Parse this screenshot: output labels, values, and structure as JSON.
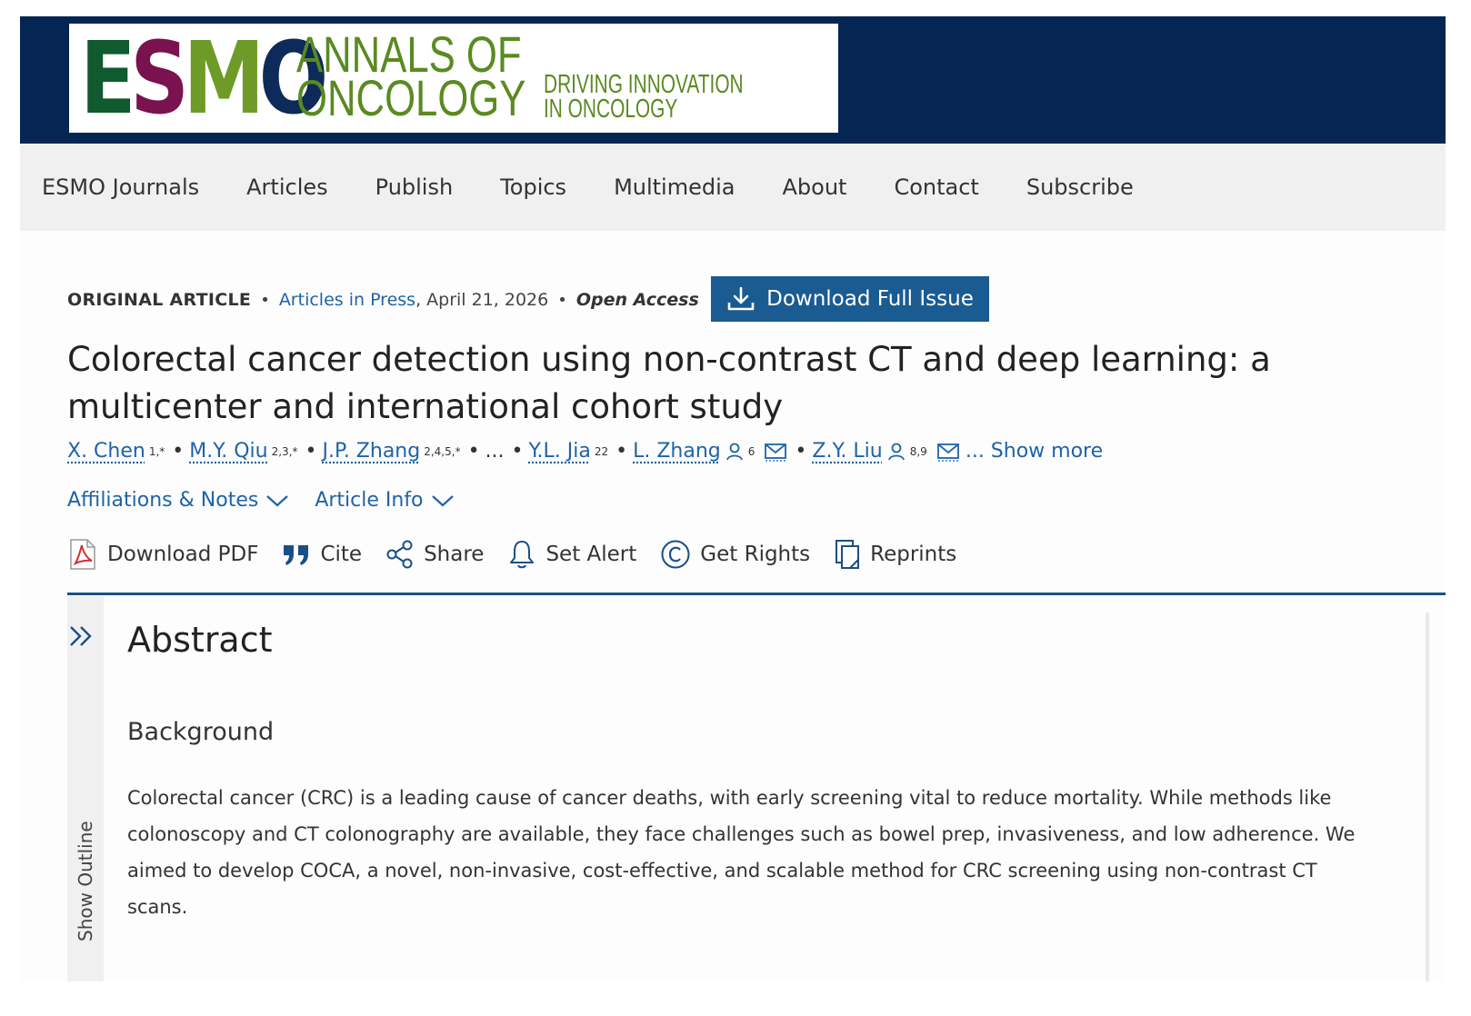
{
  "header": {
    "logo_letters": [
      "E",
      "S",
      "M",
      "O"
    ],
    "journal_line1": "ANNALS OF",
    "journal_line2": "ONCOLOGY",
    "tagline_line1": "DRIVING INNOVATION",
    "tagline_line2": "IN ONCOLOGY",
    "banner_color": "#052653"
  },
  "nav": {
    "items": [
      "ESMO Journals",
      "Articles",
      "Publish",
      "Topics",
      "Multimedia",
      "About",
      "Contact",
      "Subscribe"
    ]
  },
  "article": {
    "type": "ORIGINAL ARTICLE",
    "section_link": "Articles in Press",
    "date": ", April 21, 2026",
    "access": "Open Access",
    "download_issue": "Download Full Issue",
    "title": "Colorectal cancer detection using non-contrast CT and deep learning: a multicenter and international cohort study",
    "authors": [
      {
        "name": "X. Chen",
        "sup": "1,*"
      },
      {
        "name": "M.Y. Qiu",
        "sup": "2,3,*"
      },
      {
        "name": "J.P. Zhang",
        "sup": "2,4,5,*"
      },
      {
        "name": "Y.L. Jia",
        "sup": "22"
      },
      {
        "name": "L. Zhang",
        "sup": "6"
      },
      {
        "name": "Z.Y. Liu",
        "sup": "8,9"
      }
    ],
    "ellipsis": "...",
    "show_more": "... Show more",
    "affiliations_toggle": "Affiliations & Notes",
    "article_info_toggle": "Article Info",
    "actions": {
      "download_pdf": "Download PDF",
      "cite": "Cite",
      "share": "Share",
      "set_alert": "Set Alert",
      "get_rights": "Get Rights",
      "reprints": "Reprints"
    },
    "outline_label": "Show Outline",
    "abstract_heading": "Abstract",
    "background_heading": "Background",
    "background_text": "Colorectal cancer (CRC) is a leading cause of cancer deaths, with early screening vital to reduce mortality. While methods like colonoscopy and CT colonography are available, they face challenges such as bowel prep, invasiveness, and low adherence. We aimed to develop COCA, a novel, non-invasive, cost-effective, and scalable method for CRC screening using non-contrast CT scans."
  },
  "colors": {
    "link": "#1f63a8",
    "button": "#1a5b92",
    "rule": "#1a4f86",
    "pdf_red": "#d32f2f"
  }
}
